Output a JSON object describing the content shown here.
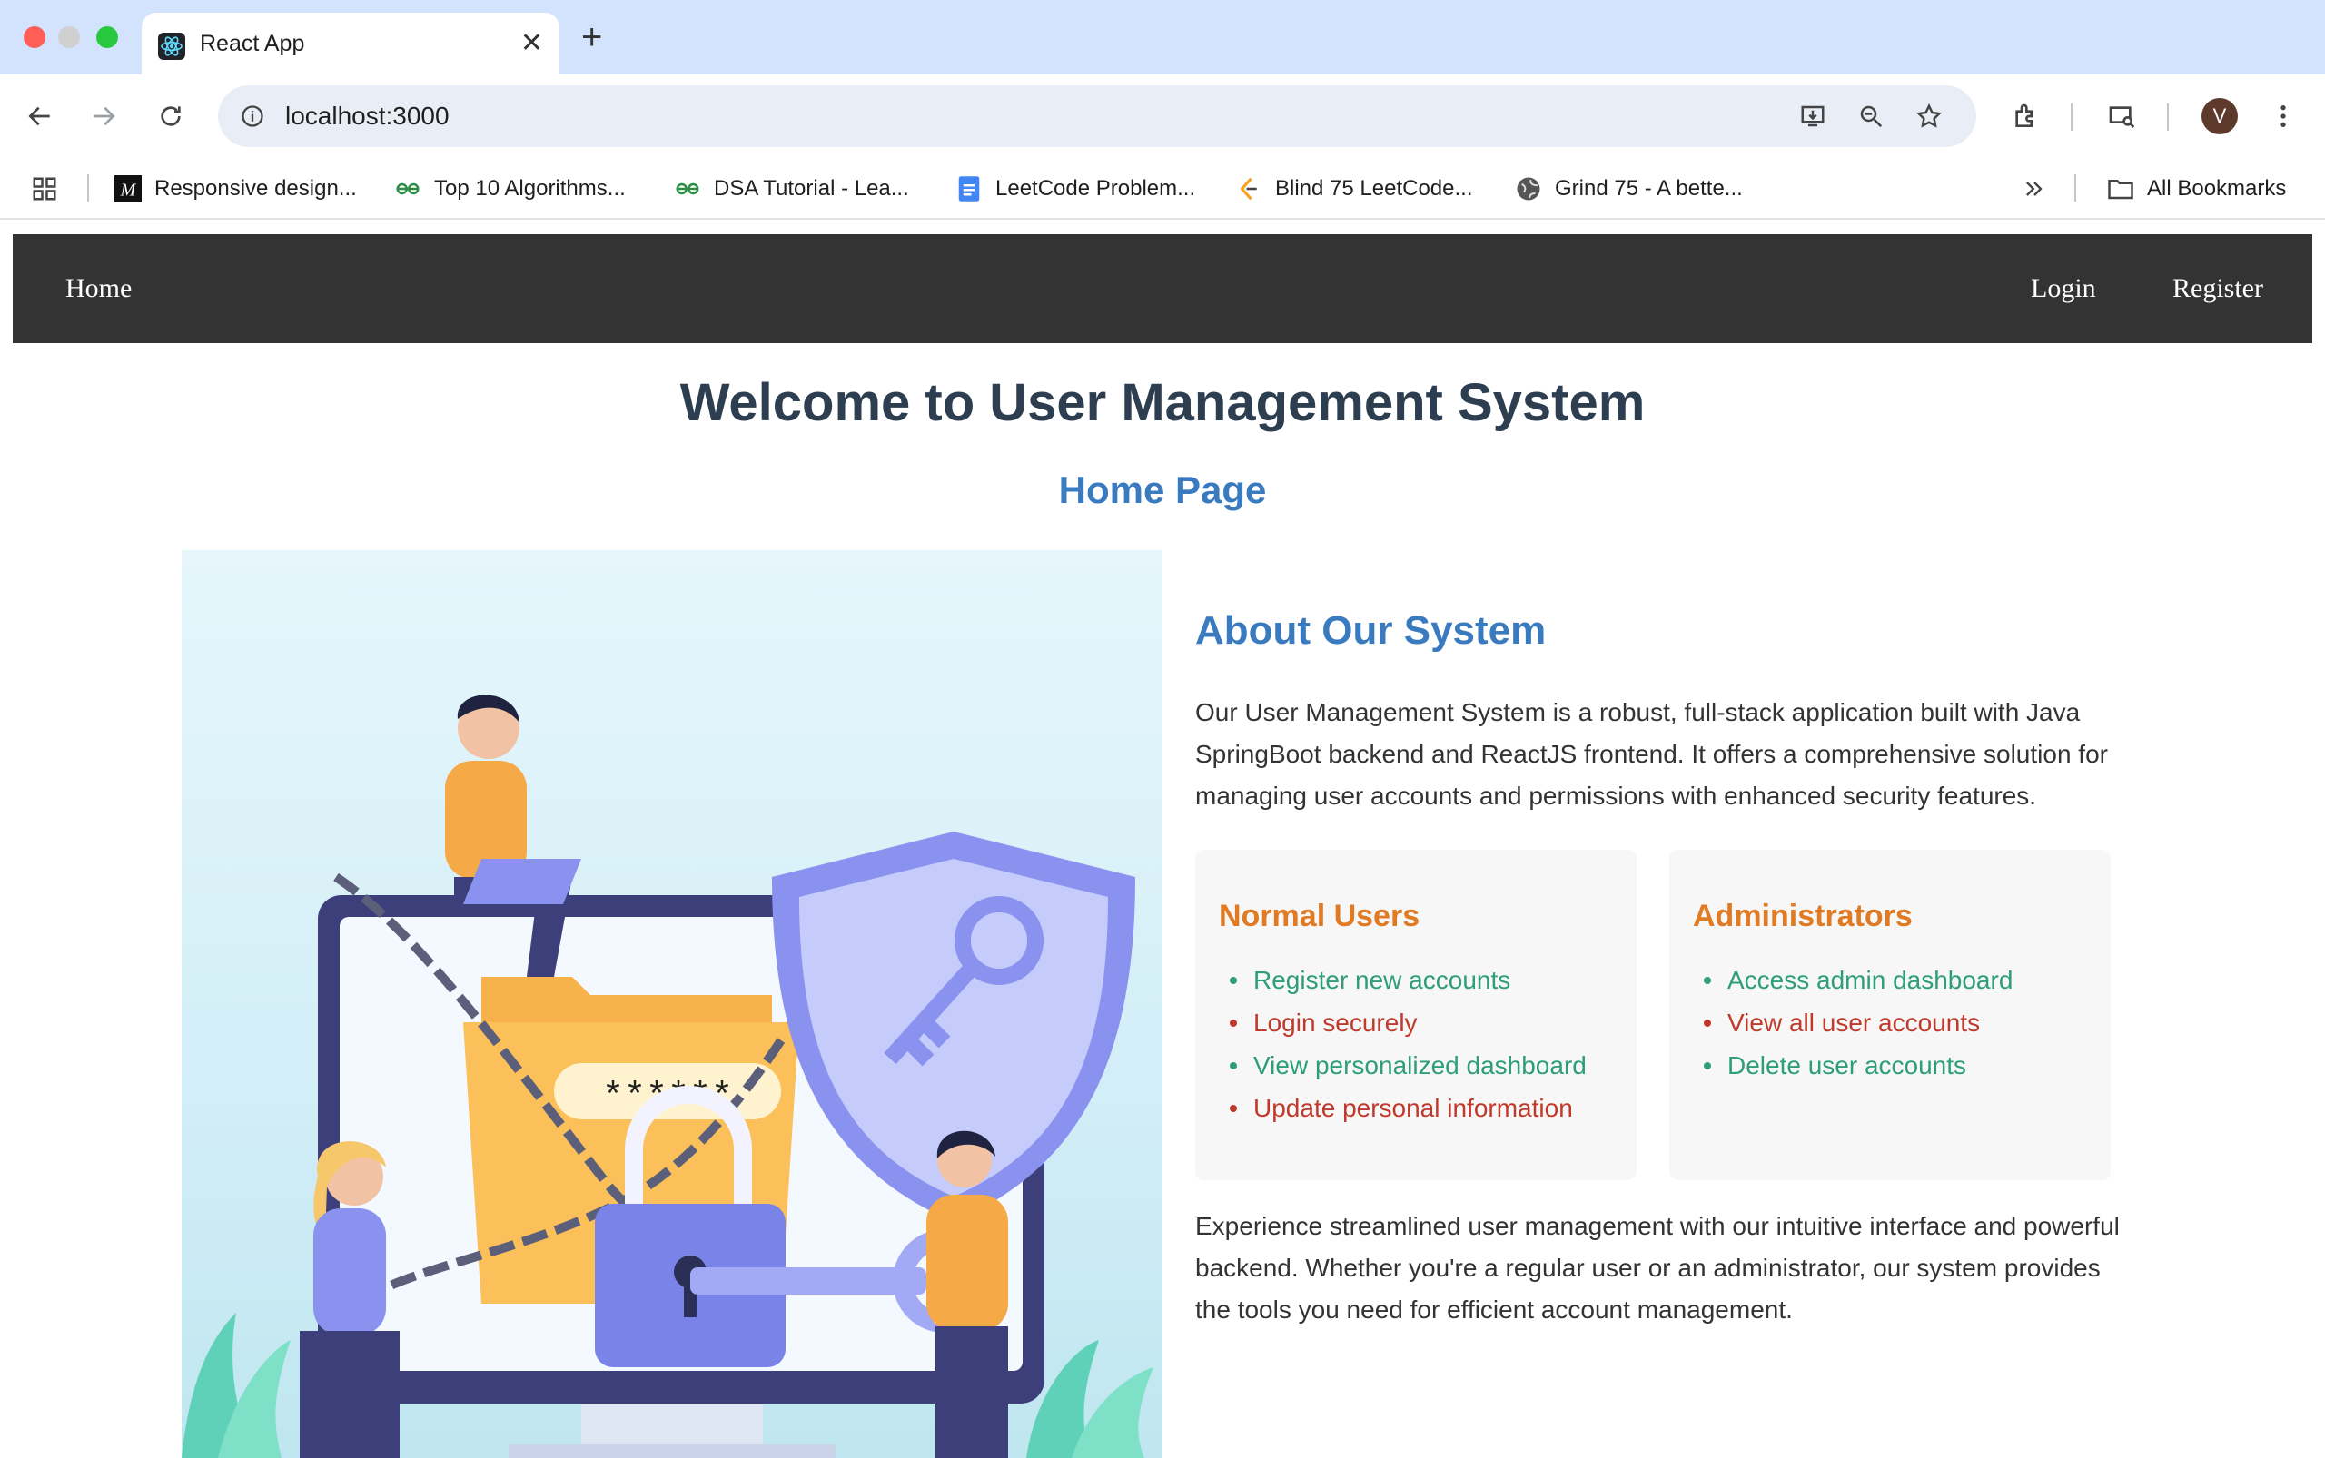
{
  "browser": {
    "tab_title": "React App",
    "url": "localhost:3000",
    "profile_initial": "V",
    "bookmarks": [
      {
        "label": "Responsive design...",
        "icon": "medium-icon"
      },
      {
        "label": "Top 10 Algorithms...",
        "icon": "geeksforgeeks-icon"
      },
      {
        "label": "DSA Tutorial - Lea...",
        "icon": "geeksforgeeks-icon"
      },
      {
        "label": "LeetCode Problem...",
        "icon": "google-docs-icon"
      },
      {
        "label": "Blind 75 LeetCode...",
        "icon": "leetcode-icon"
      },
      {
        "label": "Grind 75 - A bette...",
        "icon": "globe-icon"
      }
    ],
    "all_bookmarks": "All Bookmarks"
  },
  "navbar": {
    "home": "Home",
    "login": "Login",
    "register": "Register",
    "background": "#333333"
  },
  "main": {
    "welcome": "Welcome to User Management System",
    "subtitle": "Home Page",
    "about_title": "About Our System",
    "about_text": "Our User Management System is a robust, full-stack application built with Java SpringBoot backend and ReactJS frontend. It offers a comprehensive solution for managing user accounts and permissions with enhanced security features.",
    "normal_users": {
      "title": "Normal Users",
      "items": [
        "Register new accounts",
        "Login securely",
        "View personalized dashboard",
        "Update personal information"
      ]
    },
    "administrators": {
      "title": "Administrators",
      "items": [
        "Access admin dashboard",
        "View all user accounts",
        "Delete user accounts"
      ]
    },
    "closing_text": "Experience streamlined user management with our intuitive interface and powerful backend. Whether you're a regular user or an administrator, our system provides the tools you need for efficient account management.",
    "password_mask": "******"
  },
  "colors": {
    "accent_blue": "#3a7bbf",
    "heading_dark": "#2c3e50",
    "card_title_orange": "#e07b24",
    "list_green": "#2e9e78",
    "list_red": "#c0392b"
  }
}
